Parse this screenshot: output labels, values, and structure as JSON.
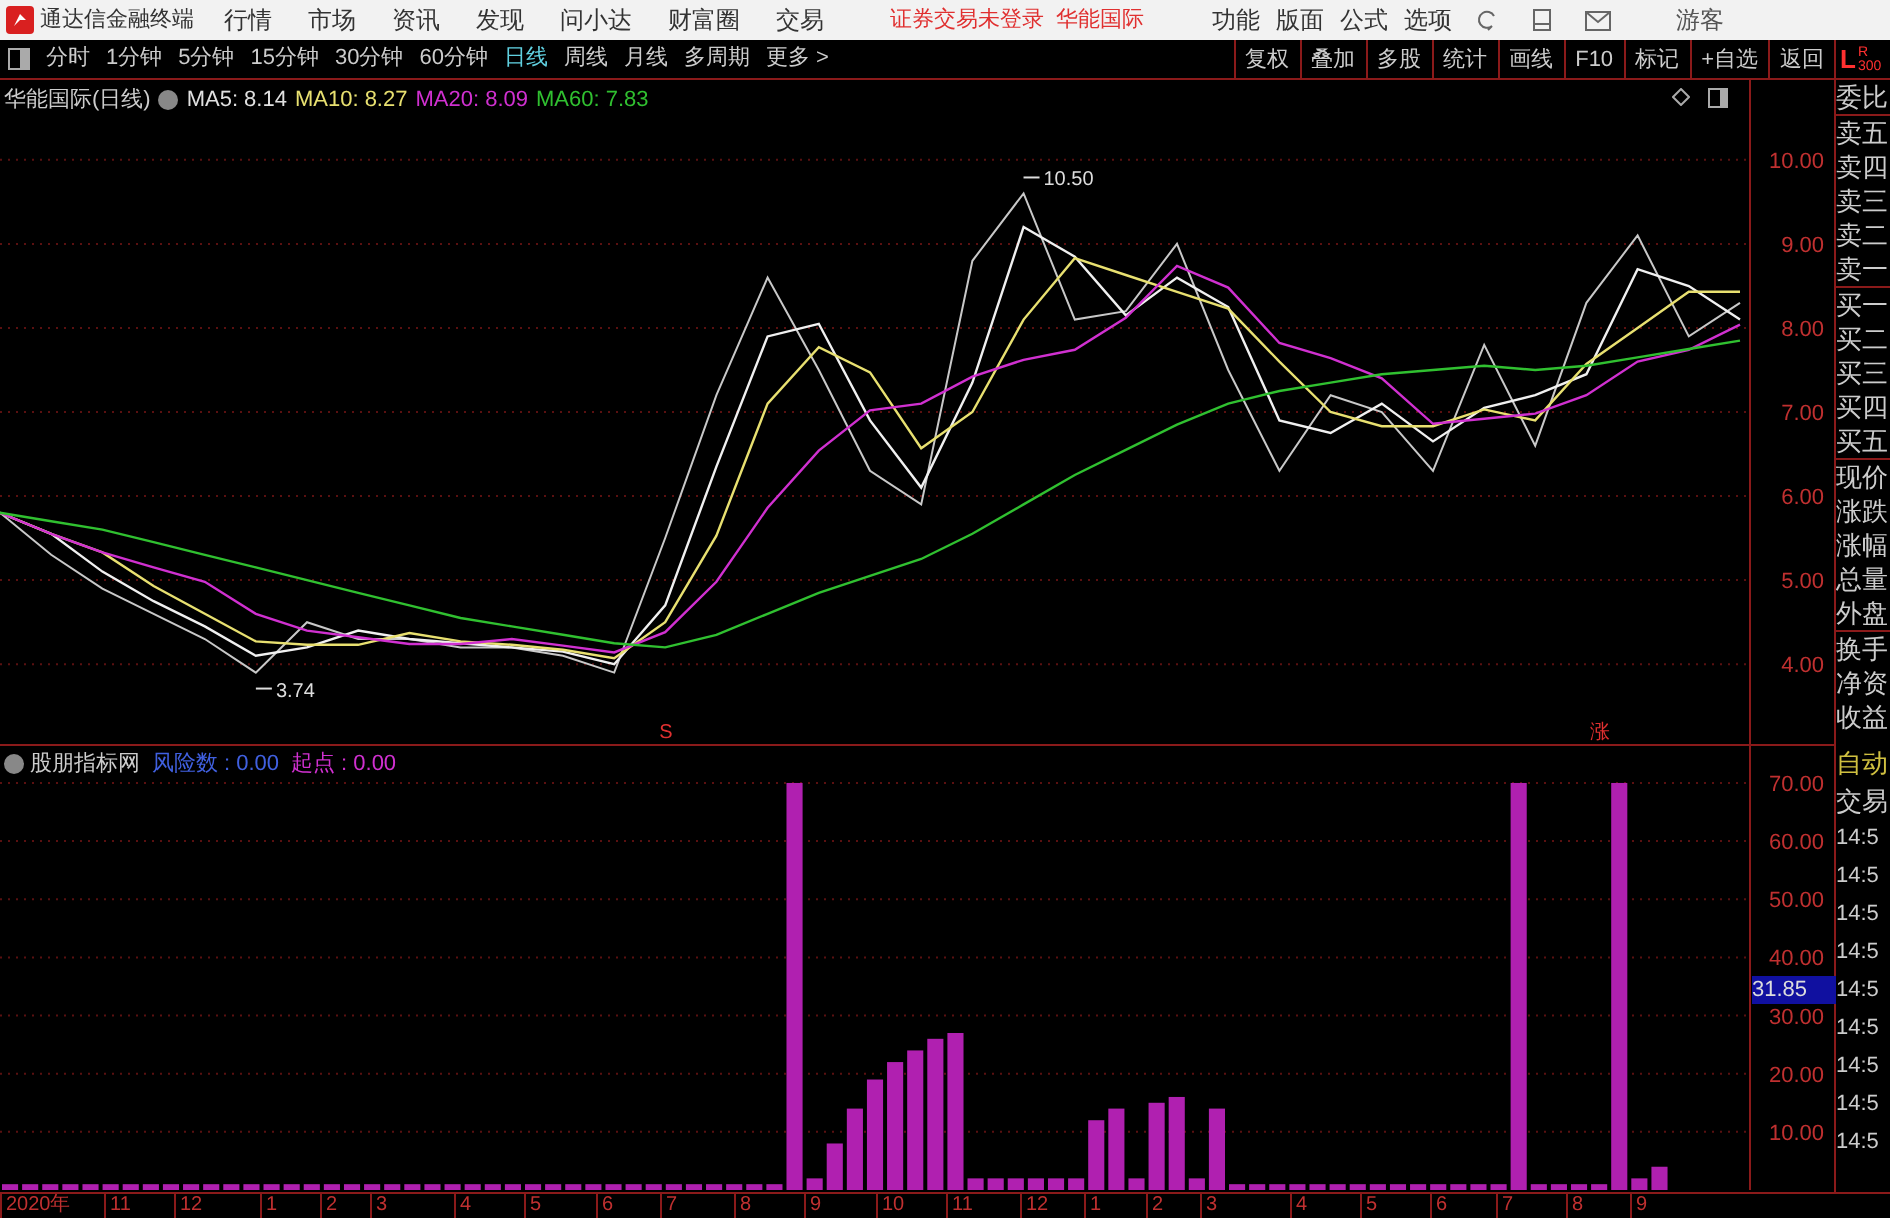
{
  "menu_bar": {
    "app_title": "通达信金融终端",
    "items": [
      "行情",
      "市场",
      "资讯",
      "发现",
      "问小达",
      "财富圈",
      "交易"
    ],
    "notice": "证券交易未登录",
    "stock": "华能国际",
    "right_items": [
      "功能",
      "版面",
      "公式",
      "选项"
    ],
    "user": "游客"
  },
  "period_tabs": [
    {
      "label": "分时",
      "selected": false
    },
    {
      "label": "1分钟",
      "selected": false
    },
    {
      "label": "5分钟",
      "selected": false
    },
    {
      "label": "15分钟",
      "selected": false
    },
    {
      "label": "30分钟",
      "selected": false
    },
    {
      "label": "60分钟",
      "selected": false
    },
    {
      "label": "日线",
      "selected": true
    },
    {
      "label": "周线",
      "selected": false
    },
    {
      "label": "月线",
      "selected": false
    },
    {
      "label": "多周期",
      "selected": false
    },
    {
      "label": "更多 >",
      "selected": false
    }
  ],
  "tool_buttons": [
    "复权",
    "叠加",
    "多股",
    "统计",
    "画线",
    "F10",
    "标记",
    "+自选",
    "返回"
  ],
  "corner": {
    "left": "L",
    "right": "R",
    "sub": "300"
  },
  "main_chart": {
    "title": "华能国际(日线)",
    "legend": [
      {
        "text": "MA5: 8.14",
        "color": "#e0e0e0"
      },
      {
        "text": "MA10: 8.27",
        "color": "#e8e070"
      },
      {
        "text": "MA20: 8.09",
        "color": "#d030d0"
      },
      {
        "text": "MA60: 7.83",
        "color": "#30c030"
      }
    ],
    "signals": [
      "S",
      "涨"
    ],
    "chart_data": {
      "type": "line",
      "grid": true,
      "yticks": [
        {
          "value": 4,
          "label": "4.00"
        },
        {
          "value": 5,
          "label": "5.00"
        },
        {
          "value": 6,
          "label": "6.00"
        },
        {
          "value": 7,
          "label": "7.00"
        },
        {
          "value": 8,
          "label": "8.00"
        },
        {
          "value": 9,
          "label": "9.00"
        },
        {
          "value": 10,
          "label": "10.00"
        }
      ],
      "ylim": [
        3.05,
        10.95
      ],
      "series": [
        {
          "color": "#c8c8c8",
          "values": [
            5.8,
            5.3,
            4.9,
            4.6,
            4.3,
            3.9,
            4.5,
            4.3,
            4.3,
            4.2,
            4.2,
            4.1,
            3.9,
            5.5,
            7.2,
            8.6,
            7.5,
            6.3,
            5.9,
            8.8,
            9.6,
            8.1,
            8.2,
            9.0,
            7.5,
            6.3,
            7.2,
            7.0,
            6.3,
            7.8,
            6.6,
            8.3,
            9.1,
            7.9,
            8.3
          ]
        },
        {
          "color": "#f0f0f0",
          "values": [
            5.8,
            5.55,
            5.1,
            4.75,
            4.45,
            4.1,
            4.2,
            4.4,
            4.3,
            4.25,
            4.2,
            4.15,
            4.0,
            4.7,
            6.35,
            7.9,
            8.05,
            6.9,
            6.1,
            7.35,
            9.2,
            8.85,
            8.15,
            8.6,
            8.25,
            6.9,
            6.75,
            7.1,
            6.65,
            7.05,
            7.2,
            7.45,
            8.7,
            8.5,
            8.1
          ]
        },
        {
          "color": "#e8e070",
          "values": [
            5.8,
            5.55,
            5.33,
            4.93,
            4.6,
            4.27,
            4.23,
            4.23,
            4.37,
            4.27,
            4.23,
            4.17,
            4.07,
            4.5,
            5.53,
            7.1,
            7.77,
            7.47,
            6.57,
            7.0,
            8.1,
            8.83,
            8.63,
            8.43,
            8.23,
            7.6,
            7.0,
            6.83,
            6.83,
            7.03,
            6.9,
            7.57,
            8.0,
            8.43,
            8.43
          ]
        },
        {
          "color": "#d030d0",
          "values": [
            5.8,
            5.55,
            5.33,
            5.15,
            4.98,
            4.6,
            4.4,
            4.32,
            4.24,
            4.24,
            4.3,
            4.22,
            4.14,
            4.38,
            4.98,
            5.86,
            6.54,
            7.02,
            7.1,
            7.42,
            7.62,
            7.74,
            8.12,
            8.74,
            8.48,
            7.82,
            7.64,
            7.4,
            6.86,
            6.92,
            6.98,
            7.2,
            7.6,
            7.74,
            8.04
          ]
        },
        {
          "color": "#30c030",
          "values": [
            5.8,
            5.7,
            5.6,
            5.45,
            5.3,
            5.15,
            5.0,
            4.85,
            4.7,
            4.55,
            4.45,
            4.35,
            4.25,
            4.2,
            4.35,
            4.6,
            4.85,
            5.05,
            5.25,
            5.55,
            5.9,
            6.25,
            6.55,
            6.85,
            7.1,
            7.25,
            7.35,
            7.45,
            7.5,
            7.55,
            7.5,
            7.55,
            7.65,
            7.75,
            7.85
          ]
        }
      ],
      "annotations": [
        "10.50",
        "3.74"
      ]
    }
  },
  "indicator": {
    "name": "股朋指标网",
    "values": [
      {
        "label": "风险数",
        "value": ": 0.00",
        "color": "#4060e0"
      },
      {
        "label": "起点",
        "value": ": 0.00",
        "color": "#d030d0"
      }
    ],
    "cursor_value": "31.85",
    "chart_data": {
      "type": "bar",
      "grid": true,
      "ylim": [
        0,
        76.7
      ],
      "yticks": [
        {
          "value": 10,
          "label": "10.00"
        },
        {
          "value": 20,
          "label": "20.00"
        },
        {
          "value": 30,
          "label": "30.00"
        },
        {
          "value": 40,
          "label": "40.00"
        },
        {
          "value": 50,
          "label": "50.00"
        },
        {
          "value": 60,
          "label": "60.00"
        },
        {
          "value": 70,
          "label": "70.00"
        }
      ],
      "series": [
        {
          "color": "#b020b0",
          "values": [
            1,
            1,
            1,
            1,
            1,
            1,
            1,
            1,
            1,
            1,
            1,
            1,
            1,
            1,
            1,
            1,
            1,
            1,
            1,
            1,
            1,
            1,
            1,
            1,
            1,
            1,
            1,
            1,
            1,
            1,
            1,
            1,
            1,
            1,
            1,
            1,
            1,
            1,
            1,
            70,
            2,
            8,
            14,
            19,
            22,
            24,
            26,
            27,
            2,
            2,
            2,
            2,
            2,
            2,
            12,
            14,
            2,
            15,
            16,
            2,
            14,
            1,
            1,
            1,
            1,
            1,
            1,
            1,
            1,
            1,
            1,
            1,
            1,
            1,
            1,
            70,
            1,
            1,
            1,
            1,
            70,
            2,
            4,
            null,
            null,
            null,
            null
          ]
        }
      ]
    }
  },
  "date_axis": [
    "2020年",
    "11",
    "12",
    "1",
    "2",
    "3",
    "4",
    "5",
    "6",
    "7",
    "8",
    "9",
    "10",
    "11",
    "12",
    "1",
    "2",
    "3",
    "4",
    "5",
    "6",
    "7",
    "8",
    "9"
  ],
  "quote_panel": [
    [
      "委比"
    ],
    [
      "卖五",
      "卖四",
      "卖三",
      "卖二",
      "卖一"
    ],
    [
      "买一",
      "买二",
      "买三",
      "买四",
      "买五"
    ],
    [
      "现价",
      "涨跌",
      "涨幅",
      "总量",
      "外盘"
    ],
    [
      "换手",
      "净资",
      "收益"
    ]
  ],
  "trade_panel": [
    {
      "text": "自动",
      "kind": "highlight"
    },
    {
      "text": "交易",
      "kind": "plain"
    },
    {
      "text": "14:5",
      "kind": "time"
    },
    {
      "text": "14:5",
      "kind": "time"
    },
    {
      "text": "14:5",
      "kind": "time"
    },
    {
      "text": "14:5",
      "kind": "time"
    },
    {
      "text": "14:5",
      "kind": "time"
    },
    {
      "text": "14:5",
      "kind": "time"
    },
    {
      "text": "14:5",
      "kind": "time"
    },
    {
      "text": "14:5",
      "kind": "time"
    },
    {
      "text": "14:5",
      "kind": "time"
    }
  ]
}
